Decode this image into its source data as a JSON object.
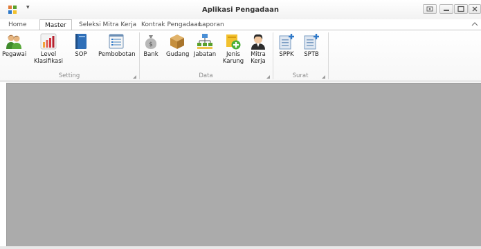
{
  "window": {
    "title": "Aplikasi Pengadaan",
    "quick_access_arrow": "▾"
  },
  "tabs": [
    {
      "label": "Home",
      "active": false
    },
    {
      "label": "Master",
      "active": true
    },
    {
      "label": "Seleksi Mitra Kerja",
      "active": false
    },
    {
      "label": "Kontrak Pengadaan",
      "active": false
    },
    {
      "label": "Laporan",
      "active": false
    }
  ],
  "ribbon": {
    "groups": [
      {
        "label": "Setting",
        "buttons": [
          {
            "label": "Pegawai",
            "icon": "people-icon"
          },
          {
            "label": "Level\nKlasifikasi",
            "icon": "bar-chart-icon"
          },
          {
            "label": "SOP",
            "icon": "book-icon"
          },
          {
            "label": "Pembobotan",
            "icon": "list-window-icon"
          }
        ]
      },
      {
        "label": "Data",
        "buttons": [
          {
            "label": "Bank",
            "icon": "money-bag-icon"
          },
          {
            "label": "Gudang",
            "icon": "box-icon"
          },
          {
            "label": "Jabatan",
            "icon": "org-chart-icon"
          },
          {
            "label": "Jenis\nKarung",
            "icon": "add-item-icon"
          },
          {
            "label": "Mitra\nKerja",
            "icon": "user-icon"
          }
        ]
      },
      {
        "label": "Surat",
        "buttons": [
          {
            "label": "SPPK",
            "icon": "new-document-icon"
          },
          {
            "label": "SPTB",
            "icon": "new-document-icon"
          }
        ]
      }
    ]
  },
  "colors": {
    "workarea": "#ababab",
    "ribbon_border": "#c4c4c4",
    "group_label": "#8c8c8c"
  }
}
